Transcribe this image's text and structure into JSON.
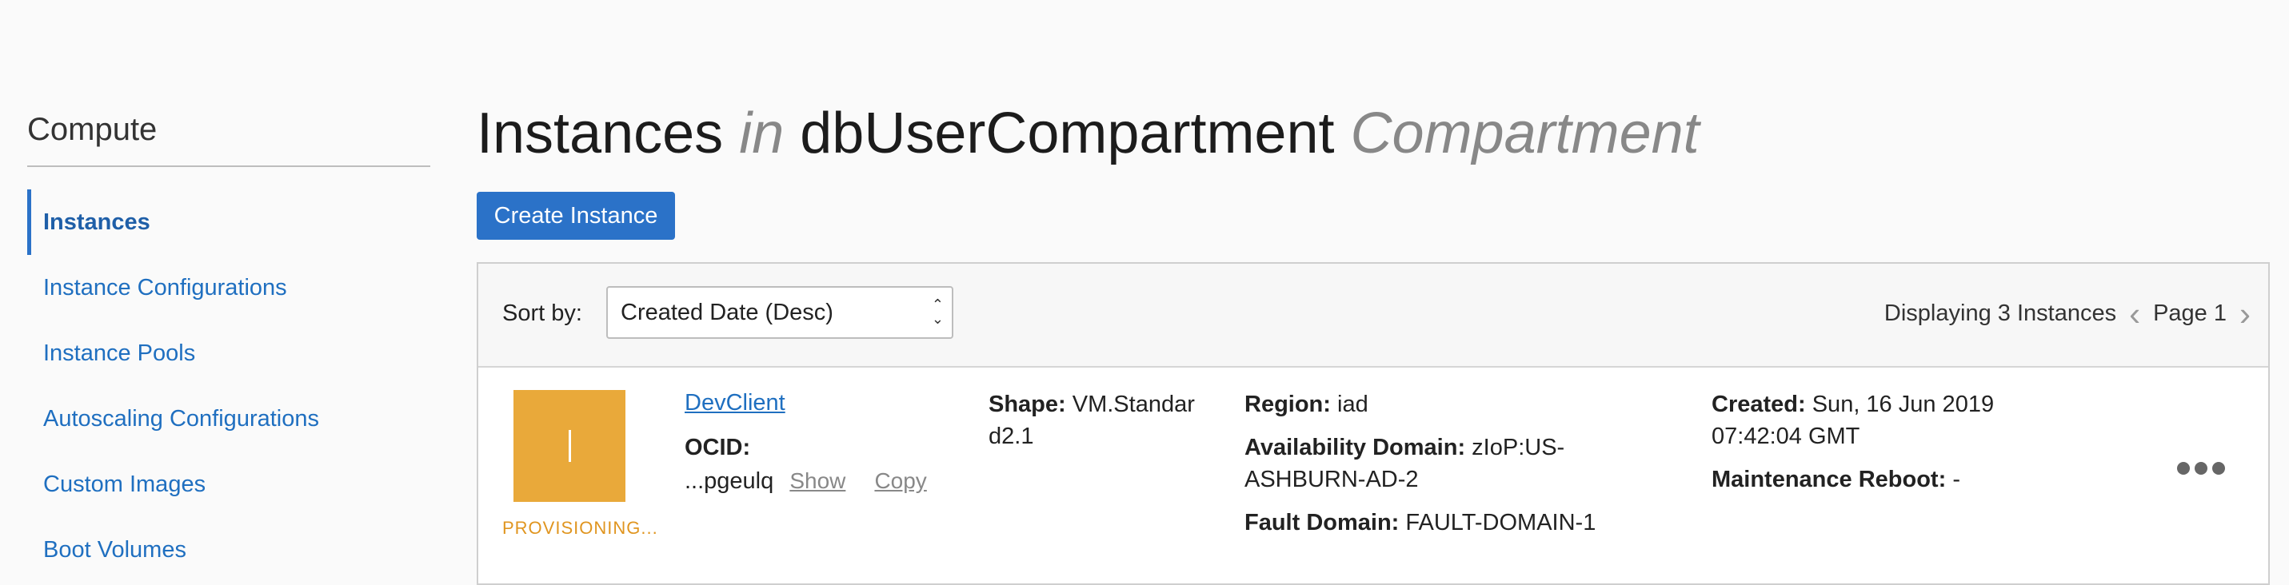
{
  "sidebar": {
    "title": "Compute",
    "items": [
      {
        "label": "Instances",
        "active": true
      },
      {
        "label": "Instance Configurations"
      },
      {
        "label": "Instance Pools"
      },
      {
        "label": "Autoscaling Configurations"
      },
      {
        "label": "Custom Images"
      },
      {
        "label": "Boot Volumes"
      }
    ]
  },
  "header": {
    "title_main": "Instances",
    "title_in": "in",
    "compartment": "dbUserCompartment",
    "title_suffix": "Compartment"
  },
  "actions": {
    "create_label": "Create Instance"
  },
  "toolbar": {
    "sort_label": "Sort by:",
    "sort_value": "Created Date (Desc)",
    "displaying": "Displaying 3 Instances",
    "page": "Page 1"
  },
  "instance": {
    "state": "PROVISIONING...",
    "name": "DevClient",
    "ocid_label": "OCID:",
    "ocid_value": "...pgeulq",
    "show_label": "Show",
    "copy_label": "Copy",
    "shape_label": "Shape:",
    "shape_value_1": "VM.Standar",
    "shape_value_2": "d2.1",
    "region_label": "Region:",
    "region_value": "iad",
    "ad_label": "Availability Domain:",
    "ad_value_1": "zIoP:US-",
    "ad_value_2": "ASHBURN-AD-2",
    "fd_label": "Fault Domain:",
    "fd_value": "FAULT-DOMAIN-1",
    "created_label": "Created:",
    "created_value_1": "Sun, 16 Jun 2019",
    "created_value_2": "07:42:04 GMT",
    "reboot_label": "Maintenance Reboot:",
    "reboot_value": "-"
  },
  "colors": {
    "accent": "#2b72c8",
    "link": "#1f6fc0",
    "provisioning": "#e9a93a"
  }
}
